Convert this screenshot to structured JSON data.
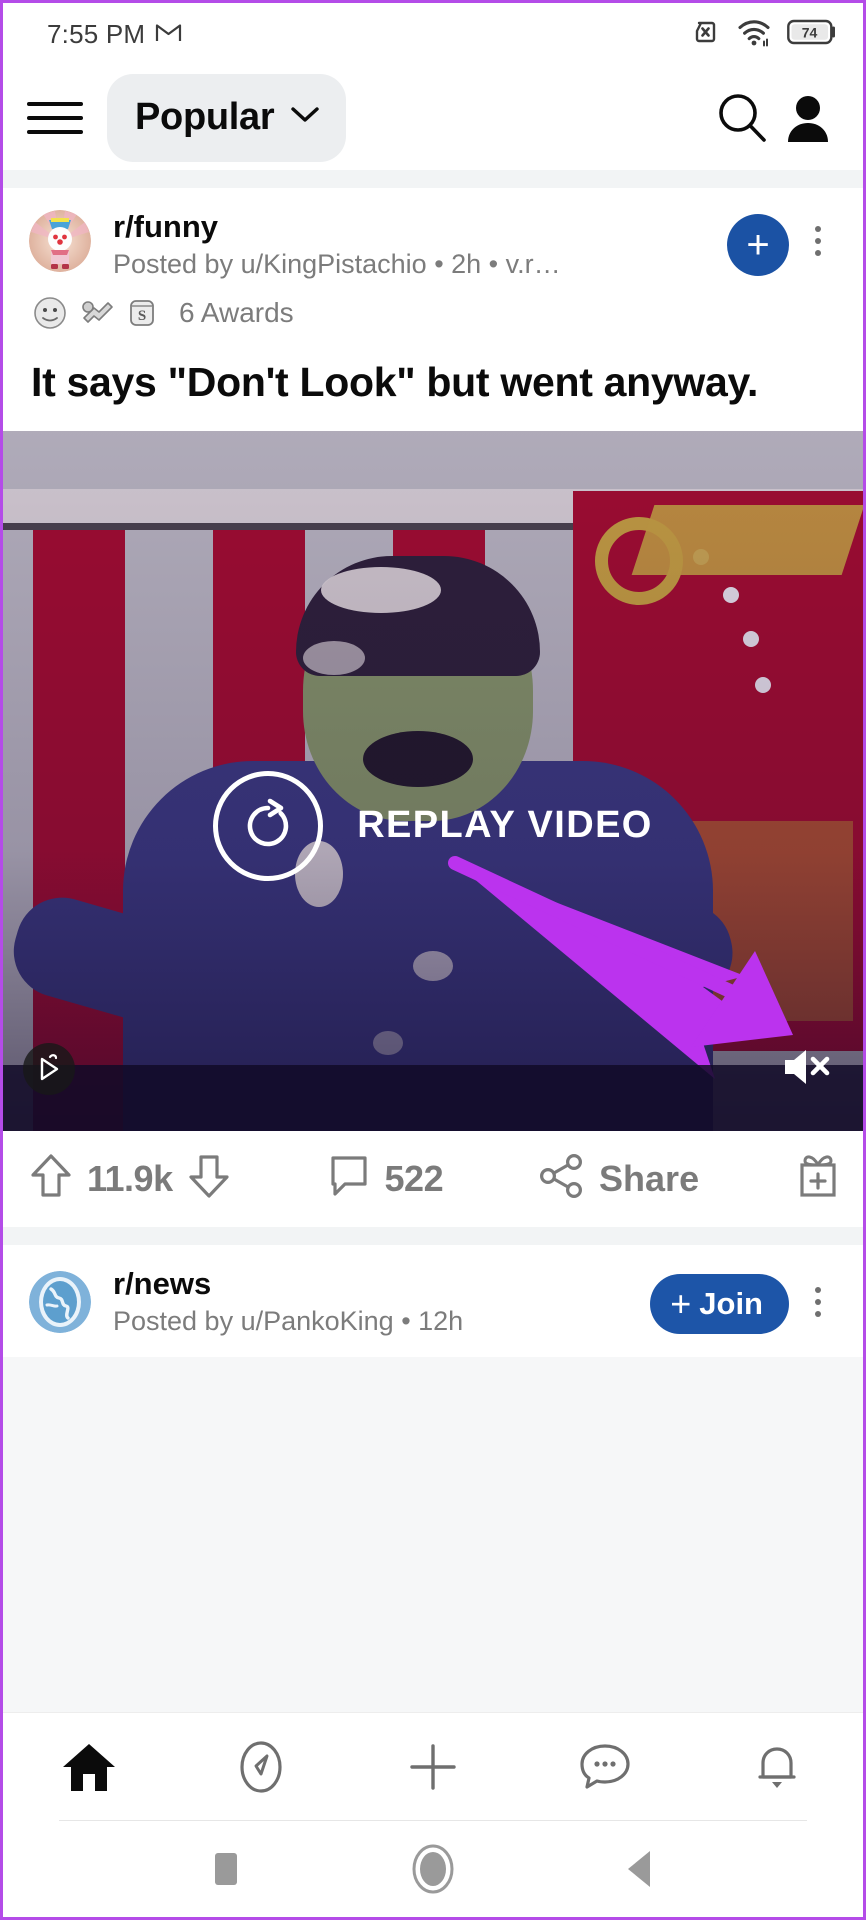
{
  "status_bar": {
    "time": "7:55 PM",
    "app_icon": "gmail-icon",
    "icons": [
      "sim-card-error-icon",
      "wifi-icon",
      "battery-icon"
    ],
    "battery_level": "74"
  },
  "app_header": {
    "menu_icon": "hamburger-menu-icon",
    "feed_label": "Popular",
    "dropdown_icon": "chevron-down-icon",
    "search_icon": "search-icon",
    "profile_icon": "account-avatar-icon"
  },
  "posts": [
    {
      "subreddit": "r/funny",
      "meta": "Posted by u/KingPistachio • 2h • v.r…",
      "awards_count": "6 Awards",
      "award_icons": [
        "award-silly-face",
        "award-helping-hand",
        "award-silver-coin"
      ],
      "join_label": "+",
      "title": "It says \"Don't Look\" but went anyway.",
      "media": {
        "type": "video",
        "overlay_label": "REPLAY VIDEO",
        "replay_icon": "replay-circular-arrow-icon",
        "mute_icon": "volume-muted-icon",
        "badge_icon": "video-play-badge-icon"
      },
      "actions": {
        "upvote_icon": "upvote-arrow-icon",
        "score": "11.9k",
        "downvote_icon": "downvote-arrow-icon",
        "comment_icon": "comment-bubble-icon",
        "comments": "522",
        "share_icon": "share-node-icon",
        "share_label": "Share",
        "award_icon": "give-award-gift-icon"
      }
    },
    {
      "subreddit": "r/news",
      "meta": "Posted by u/PankoKing • 12h",
      "join_label": "Join",
      "join_plus": "+"
    }
  ],
  "bottom_nav": {
    "items": [
      {
        "name": "home-icon",
        "active": true
      },
      {
        "name": "discover-compass-icon",
        "active": false
      },
      {
        "name": "create-post-plus-icon",
        "active": false
      },
      {
        "name": "chat-bubble-icon",
        "active": false
      },
      {
        "name": "notifications-bell-icon",
        "active": false
      }
    ]
  },
  "system_nav": {
    "recents_icon": "recents-square-icon",
    "home_icon": "home-circle-icon",
    "back_icon": "back-triangle-icon"
  },
  "colors": {
    "reddit_blue": "#1d55a8",
    "annotation_purple": "#bb33ee",
    "frame_purple": "#b44ce8",
    "muted_text": "#7c7c7c"
  }
}
